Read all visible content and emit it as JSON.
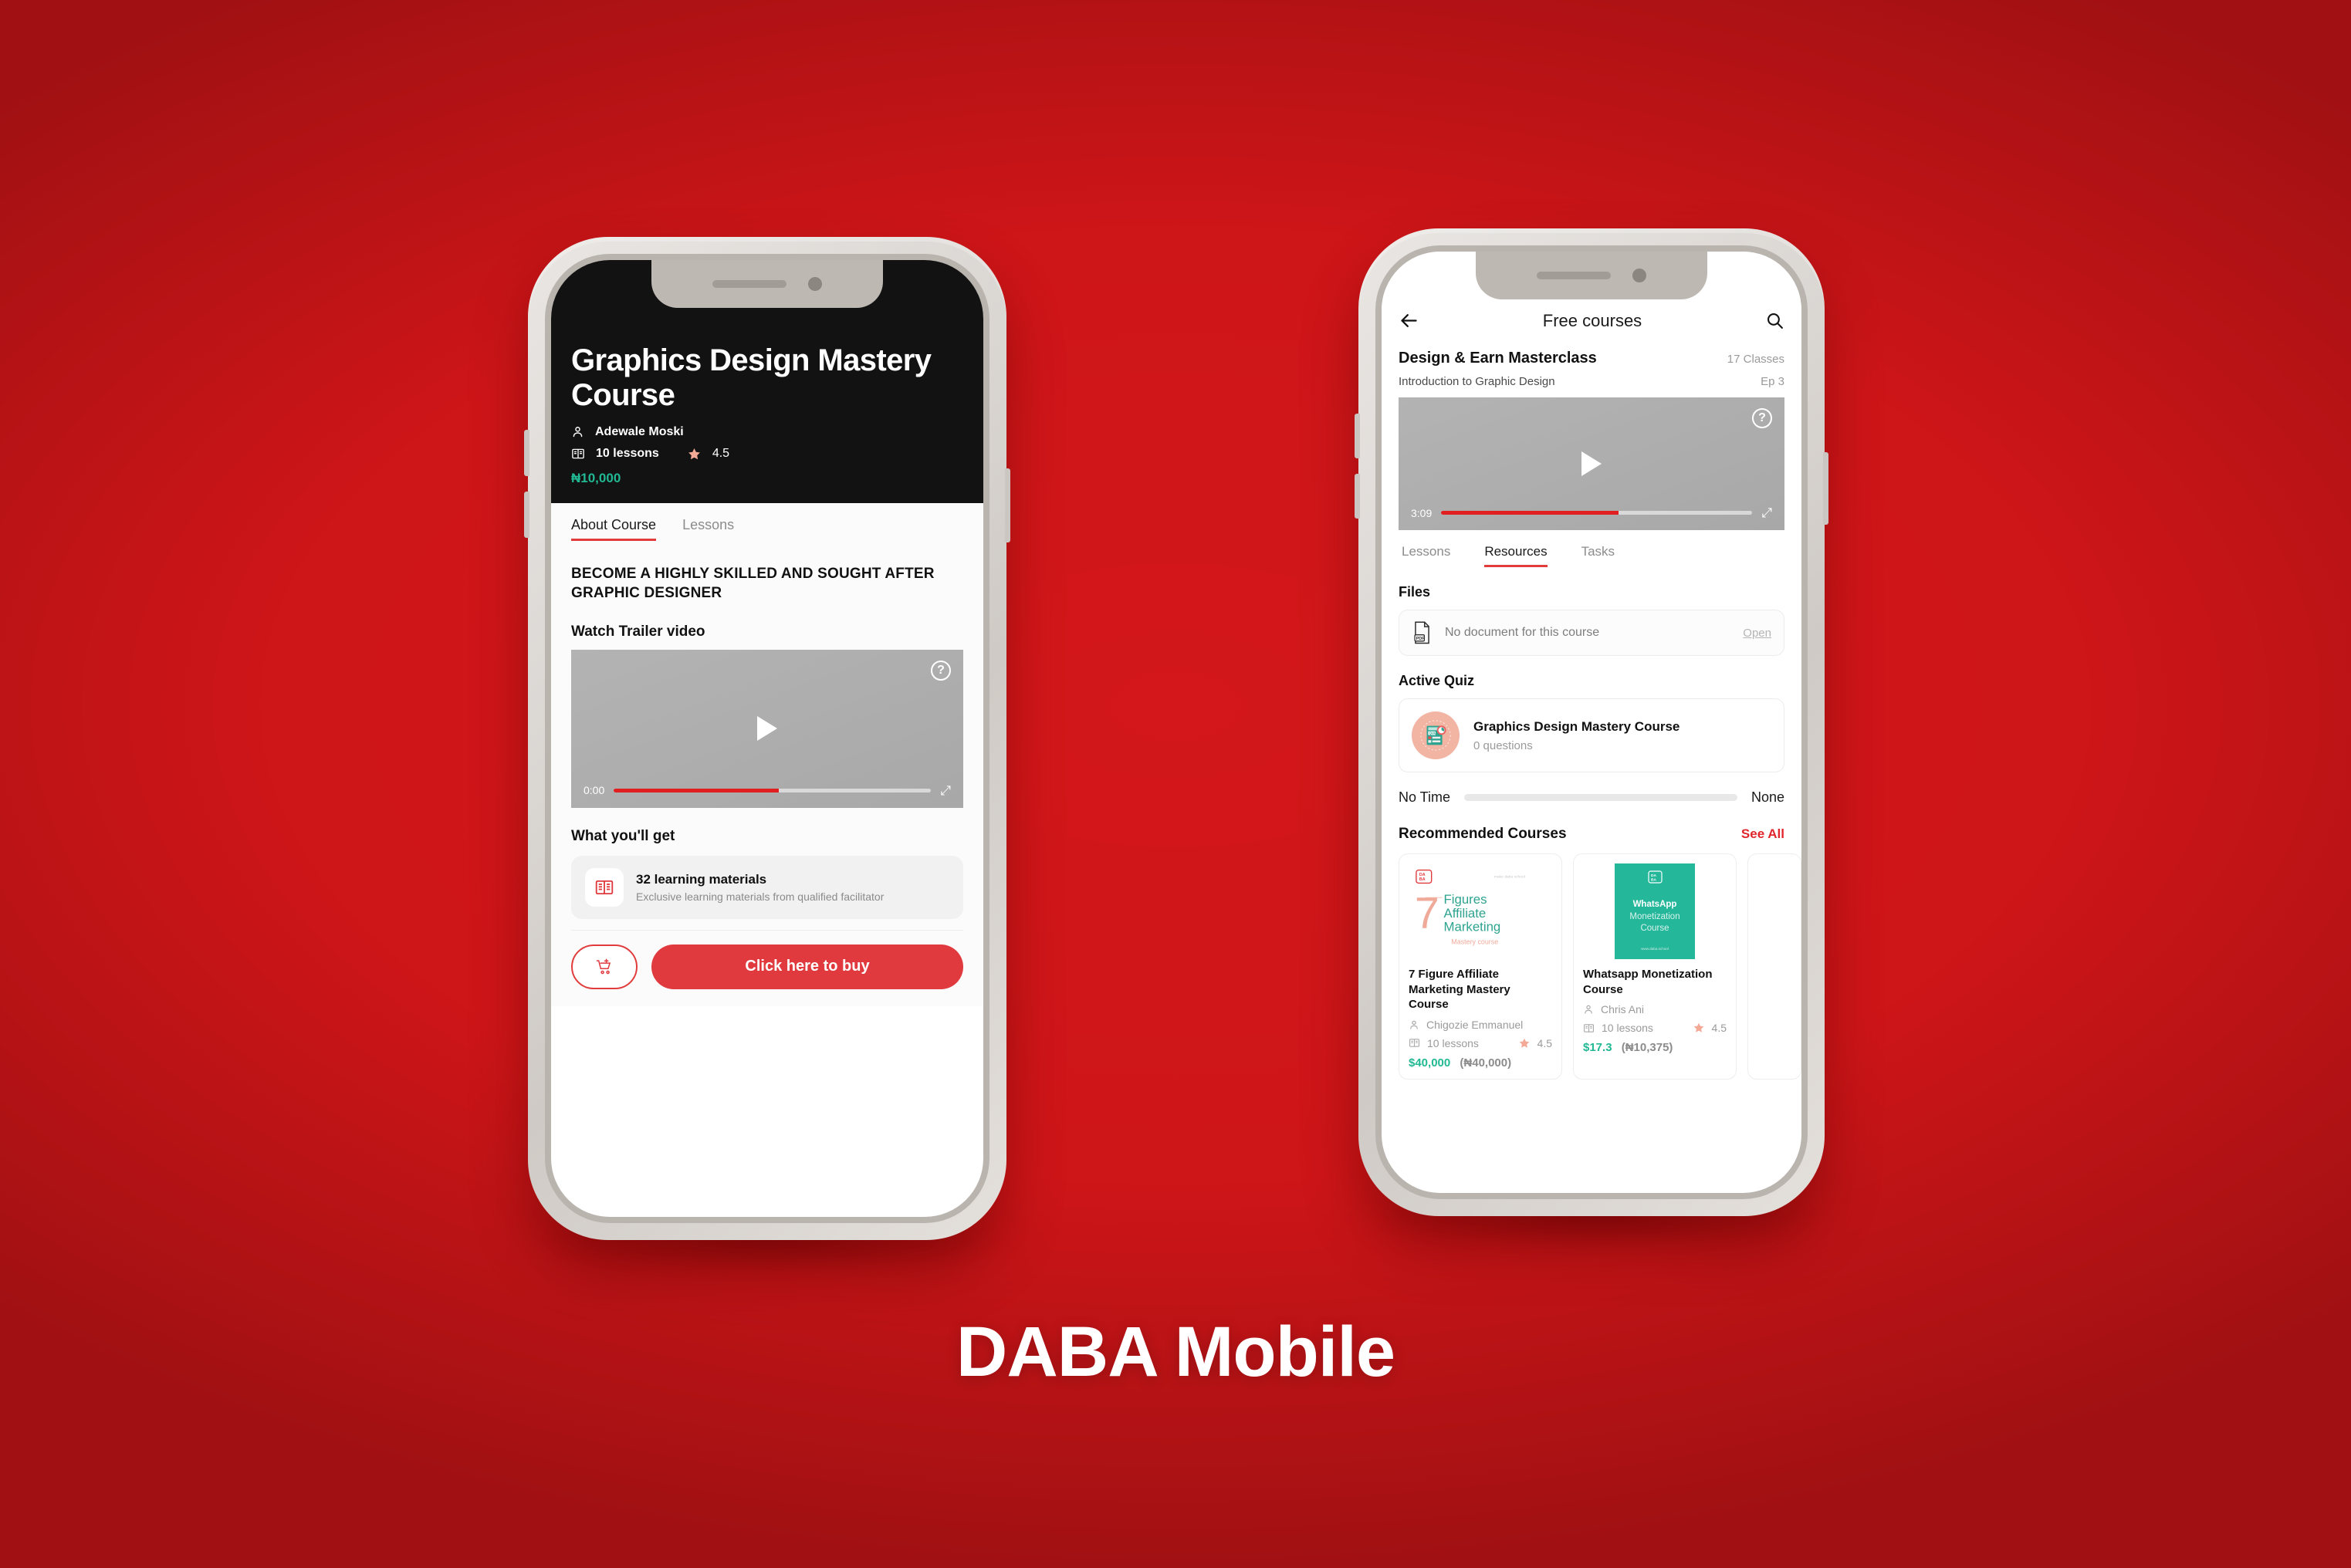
{
  "background_color": "#CE1518",
  "caption": "DABA Mobile",
  "phone1": {
    "hero": {
      "title": "Graphics Design Mastery Course",
      "instructor": "Adewale Moski",
      "lessons": "10 lessons",
      "rating": "4.5",
      "price": "₦10,000"
    },
    "tabs": [
      {
        "label": "About Course",
        "active": true
      },
      {
        "label": "Lessons",
        "active": false
      }
    ],
    "headline": "BECOME A HIGHLY SKILLED AND SOUGHT AFTER GRAPHIC DESIGNER",
    "trailer_heading": "Watch Trailer video",
    "video": {
      "time": "0:00",
      "progress_percent": 52,
      "play_icon": "play-icon",
      "help_icon": "question-mark-icon",
      "expand_icon": "expand-icon"
    },
    "what_you_get_heading": "What you'll get",
    "benefit": {
      "icon": "open-book-icon",
      "title": "32 learning materials",
      "subtitle": "Exclusive learning materials from qualified facilitator"
    },
    "footer": {
      "cart_icon": "add-to-cart-icon",
      "buy_label": "Click here to buy"
    }
  },
  "phone2": {
    "appbar": {
      "back_icon": "arrow-left-icon",
      "title": "Free courses",
      "search_icon": "search-icon"
    },
    "course_title": "Design & Earn Masterclass",
    "course_count": "17 Classes",
    "episode_title": "Introduction to Graphic Design",
    "episode_number": "Ep 3",
    "video": {
      "time": "3:09",
      "progress_percent": 57,
      "play_icon": "play-icon",
      "help_icon": "question-mark-icon",
      "expand_icon": "expand-icon"
    },
    "tabs": [
      {
        "label": "Lessons",
        "active": false
      },
      {
        "label": "Resources",
        "active": true
      },
      {
        "label": "Tasks",
        "active": false
      }
    ],
    "files_heading": "Files",
    "file_item": {
      "icon": "pdf-file-icon",
      "name": "No document for this course",
      "action": "Open"
    },
    "quiz_heading": "Active Quiz",
    "quiz_item": {
      "icon": "quiz-icon",
      "title": "Graphics Design Mastery Course",
      "subtitle": "0 questions"
    },
    "time_row": {
      "left_label": "No Time",
      "right_label": "None",
      "progress_percent": 0
    },
    "recommended": {
      "heading": "Recommended Courses",
      "see_all": "See All",
      "cards": [
        {
          "thumb_brand": "DABA",
          "thumb_tagline": "make daba school",
          "thumb_numeral": "7",
          "thumb_line1": "Figures",
          "thumb_line2": "Affiliate",
          "thumb_line3": "Marketing",
          "thumb_sub": "Mastery course",
          "title": "7 Figure Affiliate Marketing Mastery Course",
          "instructor": "Chigozie Emmanuel",
          "lessons": "10 lessons",
          "rating": "4.5",
          "price_usd": "$40,000",
          "price_ngn": "(₦40,000)"
        },
        {
          "thumb_brand": "DABA",
          "thumb_line1": "WhatsApp",
          "thumb_line2": "Monetization",
          "thumb_line3": "Course",
          "thumb_sub": "www.daba.school",
          "title": "Whatsapp Monetization Course",
          "instructor": "Chris Ani",
          "lessons": "10 lessons",
          "rating": "4.5",
          "price_usd": "$17.3",
          "price_ngn": "(₦10,375)"
        }
      ]
    }
  },
  "colors": {
    "brand_red": "#E03A3E",
    "accent_green": "#21B893",
    "teal": "#25B79A",
    "star": "#F4A896"
  }
}
